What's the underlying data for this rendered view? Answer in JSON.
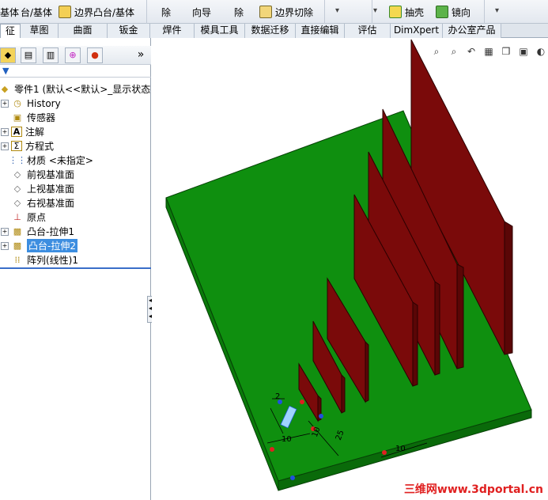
{
  "ribbon": {
    "items": [
      {
        "label": "基体",
        "icon": "boss-base-icon"
      },
      {
        "label": "台/基体",
        "icon": "revolved-boss-icon"
      },
      {
        "label": "边界凸台/基体",
        "icon": "boundary-boss-icon"
      },
      {
        "label": "除",
        "icon": ""
      },
      {
        "label": "向导",
        "icon": ""
      },
      {
        "label": "除",
        "icon": ""
      },
      {
        "label": "边界切除",
        "icon": "boundary-cut-icon"
      },
      {
        "label": "抽壳",
        "icon": "shell-icon"
      },
      {
        "label": "镜向",
        "icon": "mirror-icon"
      }
    ]
  },
  "tabs": [
    "征",
    "草图",
    "曲面",
    "钣金",
    "焊件",
    "模具工具",
    "数据迁移",
    "直接编辑",
    "评估",
    "DimXpert",
    "办公室产品"
  ],
  "tree": {
    "root": "零件1  (默认<<默认>_显示状态",
    "items": [
      {
        "label": "History",
        "expandable": true,
        "icon": "history-icon"
      },
      {
        "label": "传感器",
        "expandable": false,
        "icon": "sensor-icon"
      },
      {
        "label": "注解",
        "expandable": true,
        "icon": "annotation-icon"
      },
      {
        "label": "方程式",
        "expandable": true,
        "icon": "equation-icon"
      },
      {
        "label": "材质 <未指定>",
        "expandable": false,
        "icon": "material-icon"
      },
      {
        "label": "前视基准面",
        "expandable": false,
        "icon": "plane-icon"
      },
      {
        "label": "上视基准面",
        "expandable": false,
        "icon": "plane-icon"
      },
      {
        "label": "右视基准面",
        "expandable": false,
        "icon": "plane-icon"
      },
      {
        "label": "原点",
        "expandable": false,
        "icon": "origin-icon"
      },
      {
        "label": "凸台-拉伸1",
        "expandable": true,
        "icon": "extrude-icon"
      },
      {
        "label": "凸台-拉伸2",
        "expandable": true,
        "icon": "extrude-icon",
        "selected": true
      },
      {
        "label": "阵列(线性)1",
        "expandable": false,
        "icon": "linear-pattern-icon"
      }
    ]
  },
  "dims": {
    "d1": "2",
    "d2": "10",
    "d3": "10",
    "d4": "25",
    "d5": "10"
  },
  "watermark": "三维网www.3dportal.cn",
  "colors": {
    "base": "#0f8f0f",
    "fins": "#7a0a0a"
  }
}
